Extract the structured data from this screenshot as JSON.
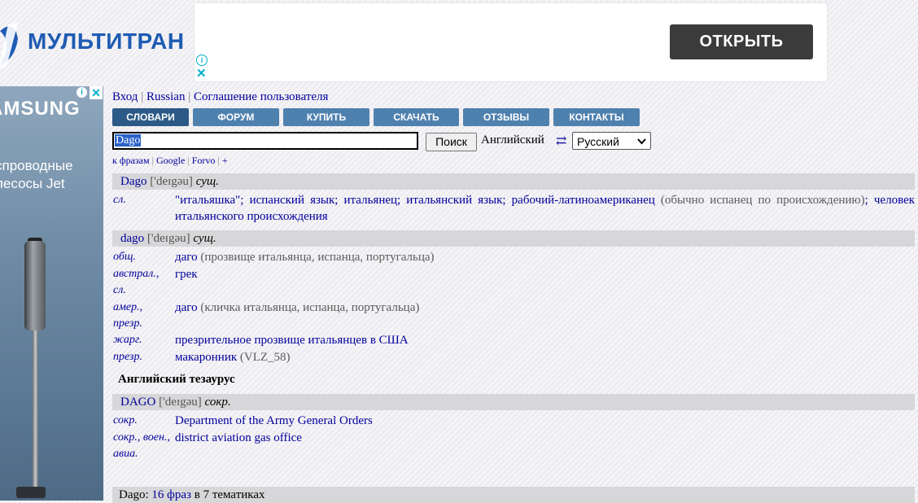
{
  "logo": {
    "text": "МУЛЬТИТРАН"
  },
  "top_ad": {
    "button_label": "ОТКРЫТЬ",
    "info_icon": "info-icon",
    "close_icon": "close-icon"
  },
  "side_ad": {
    "brand": "AMSUNG",
    "line1": "спроводные",
    "line2": "лесосы Jet"
  },
  "top_links": {
    "login": "Вход",
    "language": "Russian",
    "agreement": "Соглашение пользователя"
  },
  "nav": {
    "items": [
      {
        "label": "СЛОВАРИ",
        "active": true
      },
      {
        "label": "ФОРУМ"
      },
      {
        "label": "КУПИТЬ"
      },
      {
        "label": "СКАЧАТЬ"
      },
      {
        "label": "ОТЗЫВЫ"
      },
      {
        "label": "КОНТАКТЫ"
      }
    ]
  },
  "search": {
    "value": "Dago",
    "button": "Поиск",
    "lang_from": "Английский",
    "swap_icon": "⇄",
    "lang_to": "Русский"
  },
  "sublinks": {
    "phrases": "к фразам",
    "google": "Google",
    "forvo": "Forvo",
    "plus": "+"
  },
  "entries": [
    {
      "word": "Dago",
      "transcription": "['deɪgəu]",
      "pos": "сущ.",
      "rows": [
        {
          "subject": "сл.",
          "text": "\"итальяшка\"; испанский язык; итальянец; итальянский язык; рабочий-латиноамериканец",
          "note": "(обычно испанец по происхождению)",
          "text2": "; человек итальянского происхождения"
        }
      ]
    },
    {
      "word": "dago",
      "transcription": "['deɪgəu]",
      "pos": "сущ.",
      "rows": [
        {
          "subject": "общ.",
          "text": "даго",
          "note": "(прозвище итальянца, испанца, португальца)"
        },
        {
          "subject": "австрал., сл.",
          "text": "грек",
          "note": ""
        },
        {
          "subject": "амер., презр.",
          "text": "даго",
          "note": "(кличка итальянца, испанца, португальца)"
        },
        {
          "subject": "жарг.",
          "text": "презрительное прозвище итальянцев в США",
          "note": ""
        },
        {
          "subject": "презр.",
          "text": "макаронник",
          "note": "(VLZ_58)"
        }
      ]
    }
  ],
  "thesaurus_title": "Английский тезаурус",
  "thesaurus_entry": {
    "word": "DAGO",
    "transcription": "['deɪgəu]",
    "pos": "сокр.",
    "rows": [
      {
        "subject": "сокр.",
        "text": "Department of the Army General Orders"
      },
      {
        "subject": "сокр., воен., авиа.",
        "text": "district aviation gas office"
      }
    ]
  },
  "footer": {
    "word": "Dago",
    "phrases_link": "16 фраз",
    "rest": "в 7 тематиках"
  }
}
